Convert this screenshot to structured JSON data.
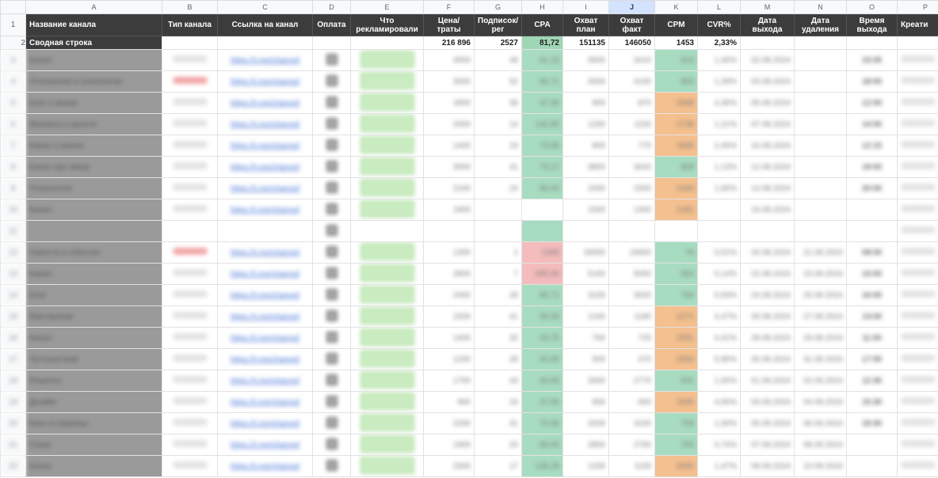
{
  "columns": [
    "A",
    "B",
    "C",
    "D",
    "E",
    "F",
    "G",
    "H",
    "I",
    "J",
    "K",
    "L",
    "M",
    "N",
    "O",
    "P"
  ],
  "selected_column": "J",
  "headers": {
    "name": "Название канала",
    "type": "Тип канала",
    "link": "Ссылка на канал",
    "payment": "Оплата",
    "advertised": "Что рекламировали",
    "price": "Цена/траты",
    "subs": "Подписок/рег",
    "cpa": "CPA",
    "reach_plan": "Охват план",
    "reach_fact": "Охват факт",
    "cpm": "CPM",
    "cvr": "CVR%",
    "date_out": "Дата выхода",
    "date_del": "Дата удаления",
    "time_out": "Время выхода",
    "creative": "Креати"
  },
  "summary": {
    "label": "Сводная строка",
    "price": "216 896",
    "subs": "2527",
    "cpa": "81,72",
    "reach_plan": "151135",
    "reach_fact": "146050",
    "cpm": "1453",
    "cvr": "2,33%"
  },
  "rows": [
    {
      "n": "3",
      "name": "Канал",
      "type": "",
      "link": "https://t.me/channel",
      "price": "4500",
      "subs": "49",
      "cpa": "91,23",
      "plan": "3500",
      "fact": "3410",
      "cpm": "923",
      "cvr": "1,40%",
      "d1": "02.08.2024",
      "d2": "",
      "t": "15:05",
      "cpmc": "green",
      "h": "green"
    },
    {
      "n": "4",
      "name": "Отношения и психология",
      "type": "red",
      "link": "https://t.me/channel",
      "price": "3500",
      "subs": "52",
      "cpa": "66,71",
      "plan": "4500",
      "fact": "4100",
      "cpm": "853",
      "cvr": "1,28%",
      "d1": "03.08.2024",
      "d2": "",
      "t": "18:00",
      "cpmc": "green",
      "h": "green"
    },
    {
      "n": "5",
      "name": "Блог о жизни",
      "type": "",
      "link": "https://t.me/channel",
      "price": "1800",
      "subs": "38",
      "cpa": "47,36",
      "plan": "900",
      "fact": "870",
      "cpm": "2068",
      "cvr": "4,36%",
      "d1": "05.08.2024",
      "d2": "",
      "t": "12:00",
      "cpmc": "orange",
      "h": "green"
    },
    {
      "n": "6",
      "name": "Финансы и деньги",
      "type": "",
      "link": "https://t.me/channel",
      "price": "2000",
      "subs": "14",
      "cpa": "142,85",
      "plan": "1200",
      "fact": "1150",
      "cpm": "1739",
      "cvr": "1,21%",
      "d1": "07.08.2024",
      "d2": "",
      "t": "14:00",
      "cpmc": "orange",
      "h": "green"
    },
    {
      "n": "7",
      "name": "Канал о книгах",
      "type": "",
      "link": "https://t.me/channel",
      "price": "1400",
      "subs": "19",
      "cpa": "73,68",
      "plan": "800",
      "fact": "775",
      "cpm": "1806",
      "cvr": "2,45%",
      "d1": "10.08.2024",
      "d2": "",
      "t": "12:15",
      "cpmc": "orange",
      "h": "green"
    },
    {
      "n": "8",
      "name": "Канал про юмор",
      "type": "",
      "link": "https://t.me/channel",
      "price": "3000",
      "subs": "41",
      "cpa": "73,17",
      "plan": "3800",
      "fact": "3620",
      "cpm": "828",
      "cvr": "1,13%",
      "d1": "12.08.2024",
      "d2": "",
      "t": "19:00",
      "cpmc": "green",
      "h": "green"
    },
    {
      "n": "9",
      "name": "Психология",
      "type": "",
      "link": "https://t.me/channel",
      "price": "2160",
      "subs": "24",
      "cpa": "90,00",
      "plan": "1600",
      "fact": "1500",
      "cpm": "1440",
      "cvr": "1,60%",
      "d1": "14.08.2024",
      "d2": "",
      "t": "20:00",
      "cpmc": "orange",
      "h": "green"
    },
    {
      "n": "10",
      "name": "Канал",
      "type": "",
      "link": "https://t.me/channel",
      "price": "1900",
      "subs": "",
      "cpa": "",
      "plan": "1500",
      "fact": "1300",
      "cpm": "1461",
      "cvr": "",
      "d1": "16.08.2024",
      "d2": "",
      "t": "",
      "cpmc": "orange",
      "h": ""
    },
    {
      "n": "11",
      "name": "",
      "type": "",
      "link": "",
      "price": "",
      "subs": "",
      "cpa": "",
      "plan": "",
      "fact": "",
      "cpm": "",
      "cvr": "",
      "d1": "",
      "d2": "",
      "t": "",
      "cpmc": "",
      "h": "green",
      "empty": true
    },
    {
      "n": "12",
      "name": "Новости и события",
      "type": "red",
      "link": "https://t.me/channel",
      "price": "1300",
      "subs": "1",
      "cpa": "1300",
      "plan": "18000",
      "fact": "16800",
      "cpm": "78",
      "cvr": "0,01%",
      "d1": "20.08.2024",
      "d2": "21.08.2024",
      "t": "09:00",
      "cpmc": "green",
      "h": "pink"
    },
    {
      "n": "13",
      "name": "Канал",
      "type": "",
      "link": "https://t.me/channel",
      "price": "2800",
      "subs": "7",
      "cpa": "400,00",
      "plan": "5100",
      "fact": "5050",
      "cpm": "554",
      "cvr": "0,14%",
      "d1": "22.08.2024",
      "d2": "23.08.2024",
      "t": "10:00",
      "cpmc": "green",
      "h": "pink"
    },
    {
      "n": "14",
      "name": "Блог",
      "type": "",
      "link": "https://t.me/channel",
      "price": "2400",
      "subs": "28",
      "cpa": "85,71",
      "plan": "3100",
      "fact": "3020",
      "cpm": "794",
      "cvr": "0,93%",
      "d1": "24.08.2024",
      "d2": "25.08.2024",
      "t": "16:00",
      "cpmc": "green",
      "h": "green"
    },
    {
      "n": "15",
      "name": "Мастерская",
      "type": "",
      "link": "https://t.me/channel",
      "price": "1500",
      "subs": "41",
      "cpa": "36,58",
      "plan": "1240",
      "fact": "1180",
      "cpm": "1271",
      "cvr": "3,47%",
      "d1": "26.08.2024",
      "d2": "27.08.2024",
      "t": "13:00",
      "cpmc": "orange",
      "h": "green"
    },
    {
      "n": "16",
      "name": "Канал",
      "type": "",
      "link": "https://t.me/channel",
      "price": "1400",
      "subs": "32",
      "cpa": "43,75",
      "plan": "760",
      "fact": "725",
      "cpm": "1931",
      "cvr": "4,41%",
      "d1": "28.08.2024",
      "d2": "29.08.2024",
      "t": "11:00",
      "cpmc": "orange",
      "h": "green"
    },
    {
      "n": "17",
      "name": "Путешествия",
      "type": "",
      "link": "https://t.me/channel",
      "price": "1200",
      "subs": "28",
      "cpa": "42,85",
      "plan": "500",
      "fact": "470",
      "cpm": "2553",
      "cvr": "5,95%",
      "d1": "30.08.2024",
      "d2": "31.08.2024",
      "t": "17:00",
      "cpmc": "orange",
      "h": "green"
    },
    {
      "n": "18",
      "name": "Рецепты",
      "type": "",
      "link": "https://t.me/channel",
      "price": "1750",
      "subs": "43",
      "cpa": "40,69",
      "plan": "2830",
      "fact": "2770",
      "cpm": "631",
      "cvr": "1,55%",
      "d1": "01.09.2024",
      "d2": "02.09.2024",
      "t": "12:30",
      "cpmc": "green",
      "h": "green"
    },
    {
      "n": "19",
      "name": "Дизайн",
      "type": "",
      "link": "https://t.me/channel",
      "price": "900",
      "subs": "24",
      "cpa": "37,50",
      "plan": "650",
      "fact": "600",
      "cpm": "1500",
      "cvr": "4,00%",
      "d1": "03.09.2024",
      "d2": "04.09.2024",
      "t": "15:30",
      "cpmc": "orange",
      "h": "green"
    },
    {
      "n": "20",
      "name": "Кино и сериалы",
      "type": "",
      "link": "https://t.me/channel",
      "price": "2200",
      "subs": "31",
      "cpa": "70,96",
      "plan": "3200",
      "fact": "3100",
      "cpm": "709",
      "cvr": "1,00%",
      "d1": "05.09.2024",
      "d2": "06.09.2024",
      "t": "19:30",
      "cpmc": "green",
      "h": "green"
    },
    {
      "n": "21",
      "name": "Спорт",
      "type": "",
      "link": "https://t.me/channel",
      "price": "1900",
      "subs": "20",
      "cpa": "95,00",
      "plan": "2800",
      "fact": "2700",
      "cpm": "703",
      "cvr": "0,74%",
      "d1": "07.09.2024",
      "d2": "08.09.2024",
      "t": "",
      "cpmc": "green",
      "h": "green"
    },
    {
      "n": "22",
      "name": "Канал",
      "type": "",
      "link": "https://t.me/channel",
      "price": "2300",
      "subs": "17",
      "cpa": "135,29",
      "plan": "1200",
      "fact": "1150",
      "cpm": "2000",
      "cvr": "1,47%",
      "d1": "09.09.2024",
      "d2": "10.09.2024",
      "t": "",
      "cpmc": "orange",
      "h": "green"
    }
  ]
}
